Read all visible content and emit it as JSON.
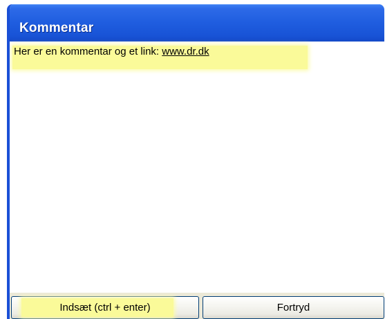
{
  "window": {
    "title": "Kommentar"
  },
  "comment": {
    "text": "Her er en kommentar og et link: ",
    "link_text": "www.dr.dk"
  },
  "buttons": {
    "insert_label": "Indsæt (ctrl + enter)",
    "cancel_label": "Fortryd"
  },
  "colors": {
    "titlebar": "#1f5ddf",
    "highlight": "#fafa99",
    "button_face": "#ecebe4"
  }
}
